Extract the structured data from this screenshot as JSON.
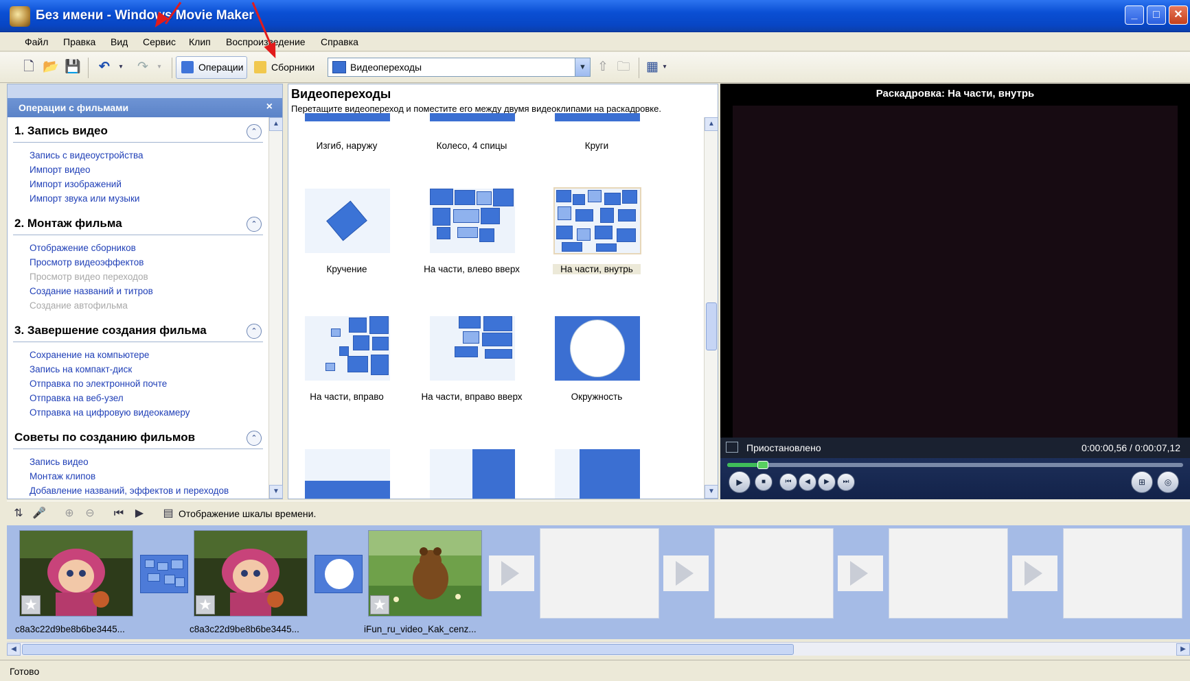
{
  "window": {
    "title": "Без имени - Windows Movie Maker",
    "minimize_glyph": "_",
    "maximize_glyph": "□",
    "close_glyph": "✕"
  },
  "menu": {
    "items": [
      "Файл",
      "Правка",
      "Вид",
      "Сервис",
      "Клип",
      "Воспроизведение",
      "Справка"
    ]
  },
  "toolbar": {
    "operations_label": "Операции",
    "collections_label": "Сборники",
    "collection_select_value": "Видеопереходы",
    "icons": [
      "new-project-icon",
      "open-project-icon",
      "save-project-icon",
      "undo-icon",
      "redo-icon",
      "up-level-icon",
      "new-collection-icon",
      "views-icon"
    ]
  },
  "tasks": {
    "header": "Операции с фильмами",
    "close_glyph": "×",
    "sections": [
      {
        "title": "1. Запись видео",
        "links": [
          {
            "label": "Запись с видеоустройства",
            "disabled": false
          },
          {
            "label": "Импорт видео",
            "disabled": false
          },
          {
            "label": "Импорт изображений",
            "disabled": false
          },
          {
            "label": "Импорт звука или музыки",
            "disabled": false
          }
        ]
      },
      {
        "title": "2. Монтаж фильма",
        "links": [
          {
            "label": "Отображение сборников",
            "disabled": false
          },
          {
            "label": "Просмотр видеоэффектов",
            "disabled": false
          },
          {
            "label": "Просмотр видео переходов",
            "disabled": true
          },
          {
            "label": "Создание названий и титров",
            "disabled": false
          },
          {
            "label": "Создание автофильма",
            "disabled": true
          }
        ]
      },
      {
        "title": "3. Завершение создания фильма",
        "links": [
          {
            "label": "Сохранение на компьютере",
            "disabled": false
          },
          {
            "label": "Запись на компакт-диск",
            "disabled": false
          },
          {
            "label": "Отправка по электронной почте",
            "disabled": false
          },
          {
            "label": "Отправка на веб-узел",
            "disabled": false
          },
          {
            "label": "Отправка на цифровую видеокамеру",
            "disabled": false
          }
        ]
      },
      {
        "title": "Советы по созданию фильмов",
        "links": [
          {
            "label": "Запись видео",
            "disabled": false
          },
          {
            "label": "Монтаж клипов",
            "disabled": false
          },
          {
            "label": "Добавление названий, эффектов и переходов",
            "disabled": false
          }
        ]
      }
    ]
  },
  "collection": {
    "title": "Видеопереходы",
    "description": "Перетащите видеопереход и поместите его между двумя видеоклипами на раскадровке.",
    "items": [
      {
        "label": "Изгиб, наружу",
        "selected": false
      },
      {
        "label": "Колесо, 4 спицы",
        "selected": false
      },
      {
        "label": "Круги",
        "selected": false
      },
      {
        "label": "Кручение",
        "selected": false
      },
      {
        "label": "На части, влево вверх",
        "selected": false
      },
      {
        "label": "На части, внутрь",
        "selected": true
      },
      {
        "label": "На части, вправо",
        "selected": false
      },
      {
        "label": "На части, вправо вверх",
        "selected": false
      },
      {
        "label": "Окружность",
        "selected": false
      }
    ]
  },
  "monitor": {
    "title": "Раскадровка: На части, внутрь",
    "status": "Приостановлено",
    "time": "0:00:00,56 / 0:00:07,12",
    "progress_fraction": 0.079
  },
  "storyboard": {
    "toggle_label": "Отображение шкалы времени.",
    "clips": [
      {
        "label": "c8a3c22d9be8b6be3445...",
        "kind": "masha"
      },
      {
        "label": "c8a3c22d9be8b6be3445...",
        "kind": "masha"
      },
      {
        "label": "iFun_ru_video_Kak_cenz...",
        "kind": "pooh"
      }
    ]
  },
  "statusbar": {
    "text": "Готово"
  },
  "colors": {
    "titlebar": "#0a4fd4",
    "link": "#1f3fb7",
    "annotation_arrow": "#e21b1b",
    "storyboard_bg": "#a5bbe6"
  }
}
